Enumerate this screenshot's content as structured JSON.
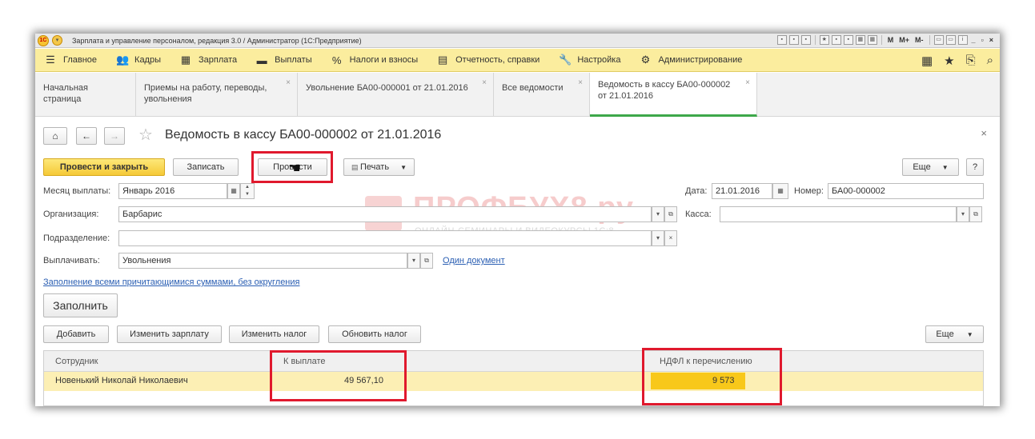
{
  "window": {
    "title": "Зарплата и управление персоналом, редакция 3.0 / Администратор (1С:Предприятие)",
    "titlebar_labels": [
      "M",
      "M+",
      "M-"
    ]
  },
  "sections": [
    {
      "icon": "menu-icon",
      "glyph": "☰",
      "label": "Главное"
    },
    {
      "icon": "people-icon",
      "glyph": "👥",
      "label": "Кадры"
    },
    {
      "icon": "calculator-icon",
      "glyph": "▦",
      "label": "Зарплата"
    },
    {
      "icon": "wallet-icon",
      "glyph": "▬",
      "label": "Выплаты"
    },
    {
      "icon": "percent-icon",
      "glyph": "%",
      "label": "Налоги и взносы"
    },
    {
      "icon": "report-icon",
      "glyph": "▤",
      "label": "Отчетность, справки"
    },
    {
      "icon": "wrench-icon",
      "glyph": "🔧",
      "label": "Настройка"
    },
    {
      "icon": "gear-icon",
      "glyph": "⚙",
      "label": "Администрирование"
    }
  ],
  "tabs": [
    {
      "label": "Начальная страница"
    },
    {
      "label": "Приемы на работу, переводы, увольнения"
    },
    {
      "label": "Увольнение БА00-000001 от 21.01.2016"
    },
    {
      "label": "Все ведомости"
    },
    {
      "label": "Ведомость в кассу БА00-000002 от 21.01.2016"
    }
  ],
  "form": {
    "title": "Ведомость в кассу БА00-000002 от 21.01.2016",
    "buttons": {
      "post_close": "Провести и закрыть",
      "save": "Записать",
      "post": "Провести",
      "print": "Печать",
      "more": "Еще",
      "help": "?"
    },
    "fields": {
      "month_label": "Месяц выплаты:",
      "month_value": "Январь 2016",
      "date_label": "Дата:",
      "date_value": "21.01.2016",
      "number_label": "Номер:",
      "number_value": "БА00-000002",
      "org_label": "Организация:",
      "org_value": "Барбарис",
      "cash_label": "Касса:",
      "cash_value": "",
      "dept_label": "Подразделение:",
      "dept_value": "",
      "pay_label": "Выплачивать:",
      "pay_value": "Увольнения",
      "one_doc_link": "Один документ"
    },
    "fill_link": "Заполнение всеми причитающимися суммами, без округления",
    "fill_button": "Заполнить",
    "table_buttons": {
      "add": "Добавить",
      "change_salary": "Изменить зарплату",
      "change_tax": "Изменить налог",
      "refresh_tax": "Обновить налог",
      "more": "Еще"
    },
    "table": {
      "columns": [
        "Сотрудник",
        "К выплате",
        "НДФЛ к перечислению"
      ],
      "rows": [
        {
          "employee": "Новенький Николай Николаевич",
          "to_pay": "49 567,10",
          "ndfl": "9 573"
        }
      ]
    }
  },
  "watermark": {
    "title": "ПРОФБУХ8.ру",
    "subtitle": "ОНЛАЙН-СЕМИНАРЫ И ВИДЕОКУРСЫ 1С:8"
  },
  "colors": {
    "accent_yellow": "#fbed9e",
    "primary_button": "#f5c937",
    "highlight_row": "#fcefb4",
    "highlight_cell": "#f8c81a",
    "annotation_red": "#e0192d",
    "active_tab": "#3da84a"
  }
}
